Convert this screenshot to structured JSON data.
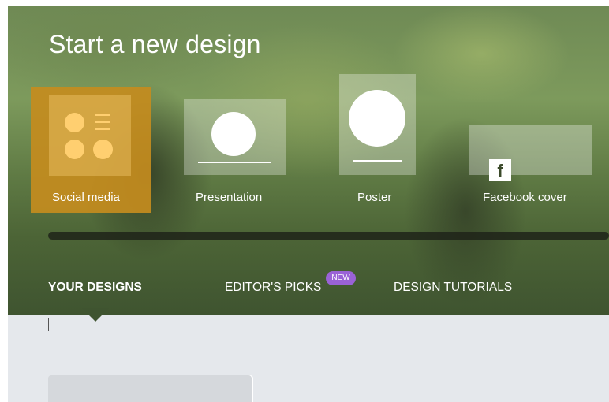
{
  "hero": {
    "title": "Start a new design"
  },
  "templates": [
    {
      "label": "Social media",
      "icon": "social-media-layout-icon",
      "selected": true
    },
    {
      "label": "Presentation",
      "icon": "presentation-layout-icon"
    },
    {
      "label": "Poster",
      "icon": "poster-layout-icon"
    },
    {
      "label": "Facebook cover",
      "icon": "facebook-icon",
      "icon_glyph": "f"
    }
  ],
  "tabs": [
    {
      "label": "YOUR DESIGNS",
      "active": true
    },
    {
      "label": "EDITOR'S PICKS",
      "badge": "NEW"
    },
    {
      "label": "DESIGN TUTORIALS"
    }
  ],
  "colors": {
    "selected_tile": "#c48c1e",
    "badge": "#9a62d6",
    "content_bg": "#e5e8ec"
  }
}
